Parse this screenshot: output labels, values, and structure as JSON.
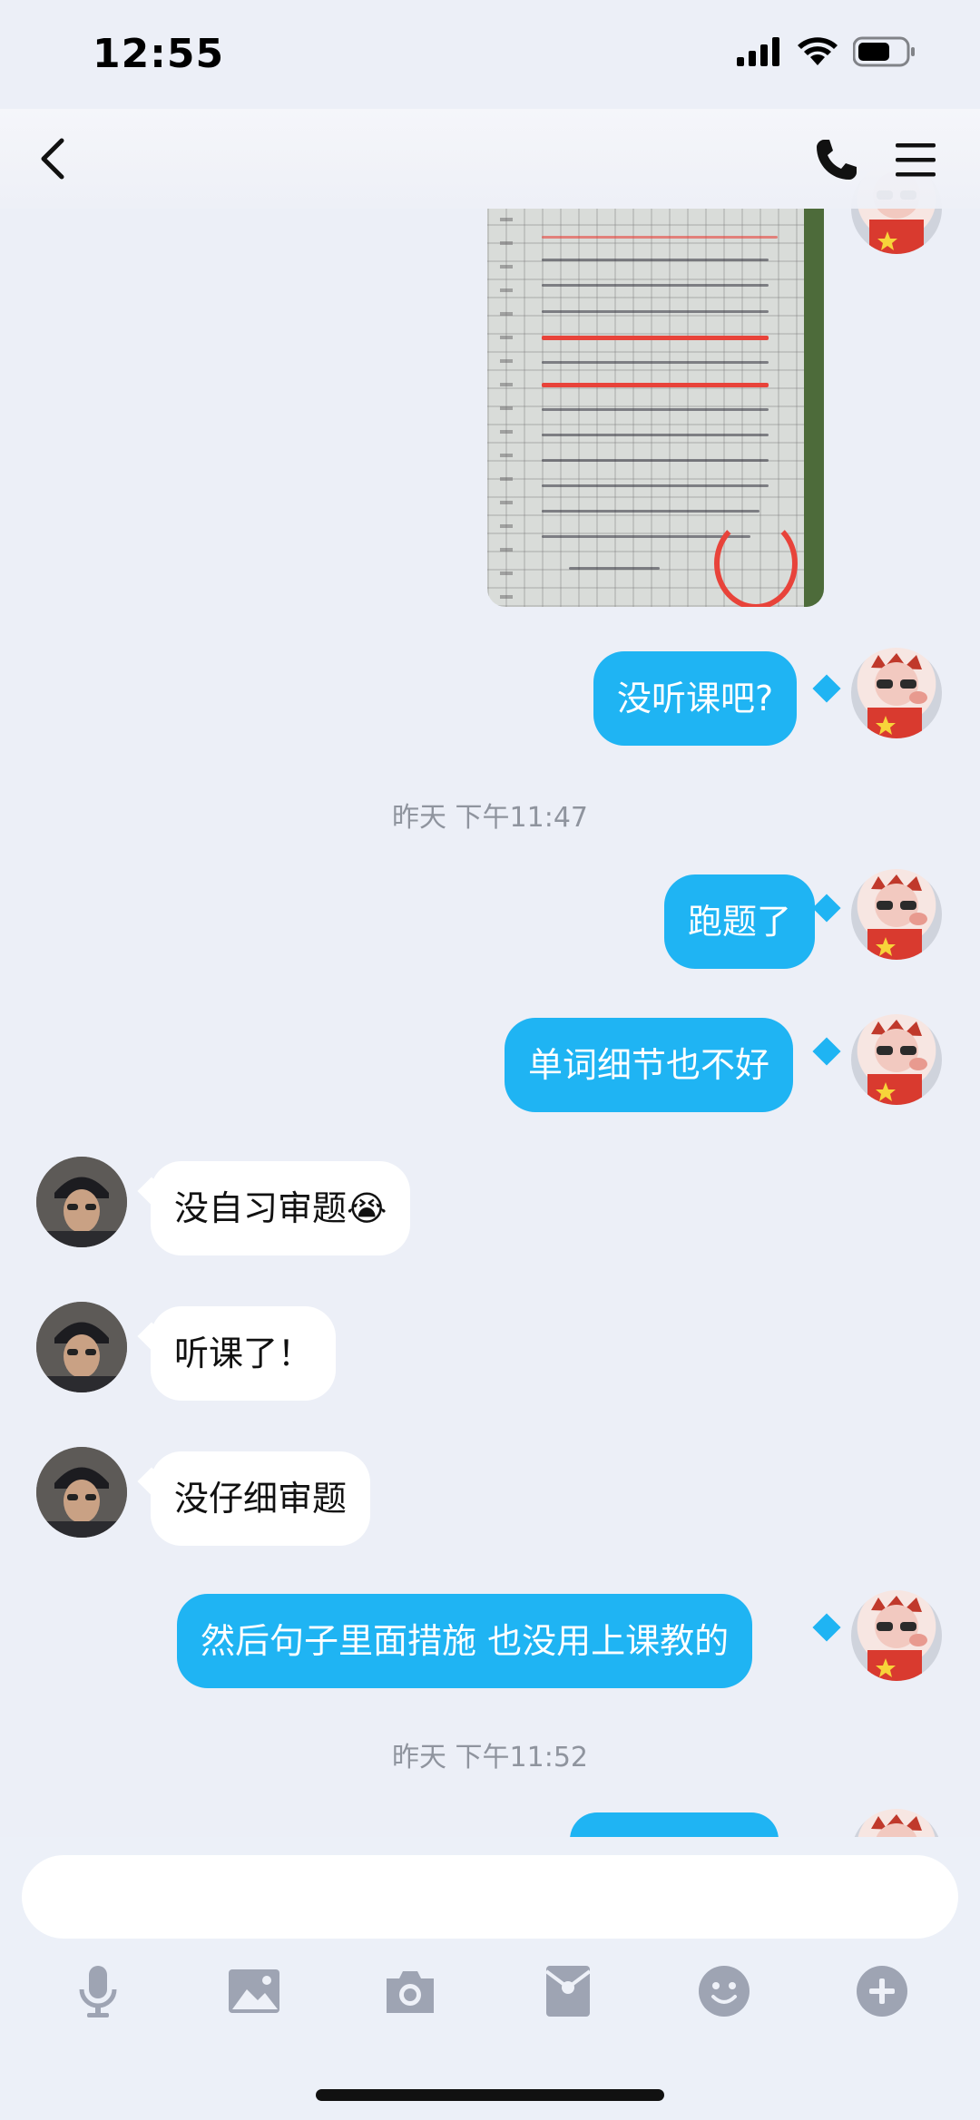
{
  "status_bar": {
    "time": "12:55",
    "icons": [
      "cellular-signal-icon",
      "wifi-icon",
      "battery-icon"
    ]
  },
  "nav_bar": {
    "icons": [
      "back-chevron-icon",
      "phone-icon",
      "menu-icon"
    ]
  },
  "messages": [
    {
      "type": "image",
      "side": "out",
      "description_icon": "handwritten-essay-photo"
    },
    {
      "type": "text",
      "side": "out",
      "text": "没听课吧?"
    },
    {
      "type": "timestamp",
      "text": "昨天 下午11:47"
    },
    {
      "type": "text",
      "side": "out",
      "text": "跑题了"
    },
    {
      "type": "text",
      "side": "out",
      "text": "单词细节也不好"
    },
    {
      "type": "text",
      "side": "in",
      "text": "没自习审题😭"
    },
    {
      "type": "text",
      "side": "in",
      "text": "听课了！"
    },
    {
      "type": "text",
      "side": "in",
      "text": "没仔细审题"
    },
    {
      "type": "text",
      "side": "out",
      "text": "然后句子里面措施 也没用上课教的"
    },
    {
      "type": "timestamp",
      "text": "昨天 下午11:52"
    },
    {
      "type": "text",
      "side": "out",
      "text": ""
    }
  ],
  "input": {
    "placeholder": "",
    "value": ""
  },
  "toolbar": {
    "icons": [
      "microphone-icon",
      "image-icon",
      "camera-icon",
      "red-packet-icon",
      "emoji-icon",
      "plus-icon"
    ]
  },
  "colors": {
    "outgoing_bubble": "#1fb4f3",
    "incoming_bubble": "#ffffff",
    "background": "#eceff7",
    "timestamp_text": "#8f949e",
    "toolbar_icon": "#9ea4b3"
  }
}
